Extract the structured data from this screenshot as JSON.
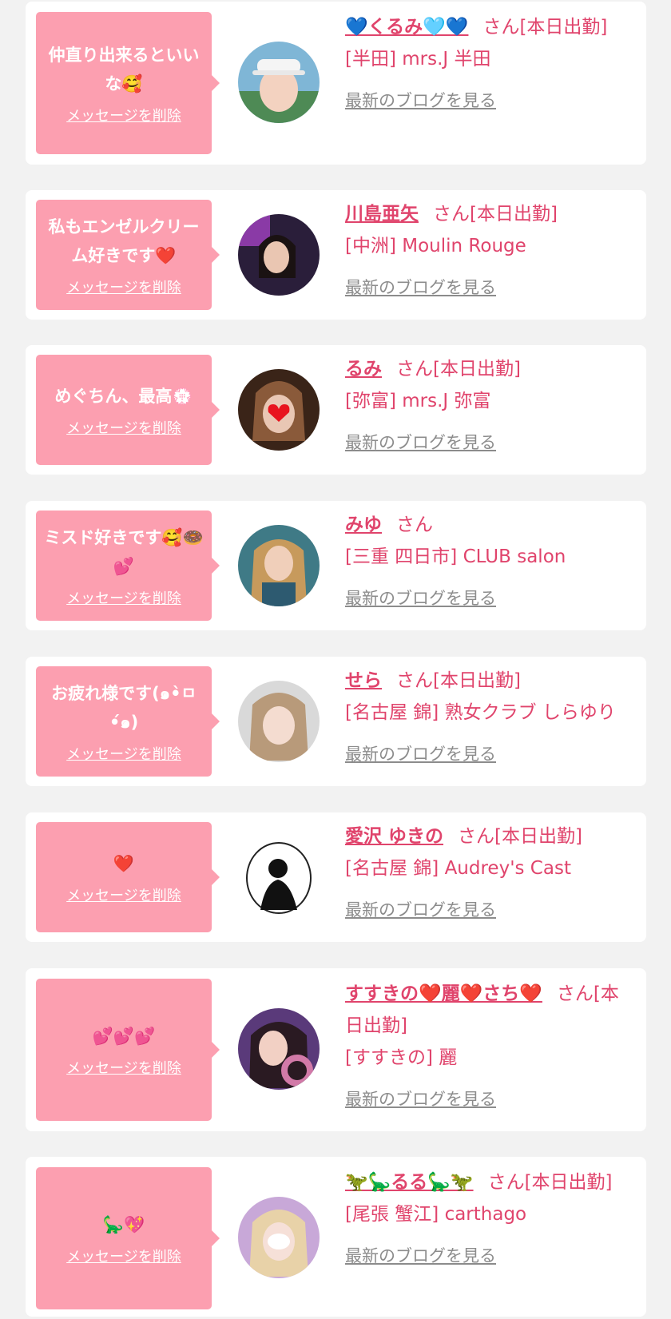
{
  "colors": {
    "background": "#f2f2f2",
    "card": "#ffffff",
    "bubble": "#fc9fb0",
    "accent": "#e0446c",
    "blog_link": "#8c8c8c",
    "heart": "#ee1f2f"
  },
  "common": {
    "delete_label": "メッセージを削除",
    "blog_label": "最新のブログを見る"
  },
  "items": [
    {
      "message": "仲直り出来るといいな🥰",
      "cast_name": "💙くるみ🩵💙",
      "suffix": "さん[本日出勤]",
      "shop": "[半田] mrs.J 半田",
      "avatar_icon": "cast-photo"
    },
    {
      "message": "私もエンゼルクリーム好きです❤️",
      "cast_name": "川島亜矢",
      "suffix": "さん[本日出勤]",
      "shop": "[中洲] Moulin Rouge",
      "avatar_icon": "cast-photo"
    },
    {
      "message": "めぐちん、最高💮",
      "cast_name": "るみ",
      "suffix": "さん[本日出勤]",
      "shop": "[弥富] mrs.J 弥富",
      "avatar_icon": "cast-photo"
    },
    {
      "message": "ミスド好きです🥰🍩💕",
      "cast_name": "みゆ",
      "suffix": "さん",
      "shop": "[三重 四日市] CLUB salon",
      "avatar_icon": "cast-photo"
    },
    {
      "message": "お疲れ様です(๑•̀ㅁ•́๑)",
      "cast_name": "せら",
      "suffix": "さん[本日出勤]",
      "shop": "[名古屋 錦] 熟女クラブ しらゆり",
      "avatar_icon": "cast-photo"
    },
    {
      "message": "❤️",
      "cast_name": "愛沢 ゆきの",
      "suffix": "さん[本日出勤]",
      "shop": "[名古屋 錦] Audrey's Cast",
      "avatar_icon": "shop-logo"
    },
    {
      "message": "💕💕💕",
      "cast_name": "すすきの❤️麗❤️さち❤️",
      "suffix": "さん[本日出勤]",
      "shop": "[すすきの] 麗",
      "avatar_icon": "cast-photo"
    },
    {
      "message": "🦕💖",
      "cast_name": "🦖🦕るる🦕🦖",
      "suffix": "さん[本日出勤]",
      "shop": "[尾張 蟹江] carthago",
      "avatar_icon": "cast-photo"
    }
  ]
}
